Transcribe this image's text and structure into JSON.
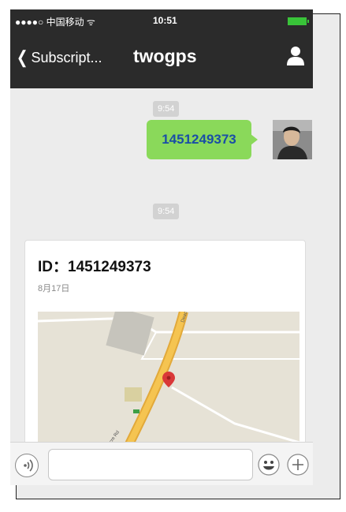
{
  "status": {
    "carrier": "●●●●○ 中国移动 ᯤ",
    "time": "10:51"
  },
  "nav": {
    "back_label": "Subscript...",
    "title": "twogps"
  },
  "messages": [
    {
      "timestamp": "9:54",
      "text": "1451249373"
    },
    {
      "timestamp": "9:54"
    }
  ],
  "card": {
    "id_line": "ID：1451249373",
    "date": "8月17日",
    "map_road_label": "Deacre Rd"
  },
  "input": {
    "placeholder": ""
  }
}
